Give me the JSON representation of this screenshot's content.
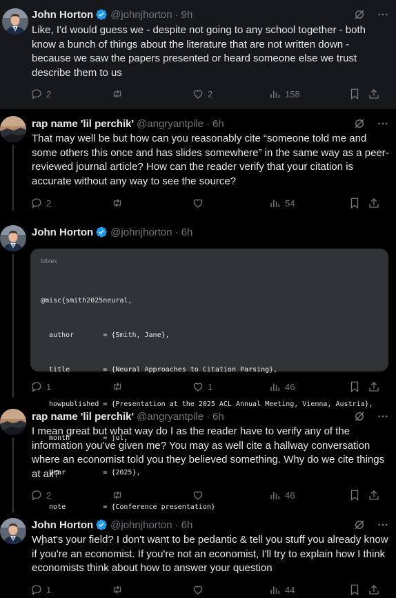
{
  "tweets": [
    {
      "name": "John Horton",
      "handle": "@johnjhorton",
      "time": "9h",
      "verified": true,
      "text": "Like, I'd would guess we - despite not going to any school together - both know a bunch of things about the literature that are not written down - because we saw the papers presented or heard someone else we trust describe them to us",
      "replies": "2",
      "retweets": "",
      "likes": "2",
      "views": "158"
    },
    {
      "name": "rap name 'lil perchik'",
      "handle": "@angryantpile",
      "time": "6h",
      "verified": false,
      "text": "That may well be but how can you reasonably cite “someone told me and some others this once and has slides somewhere” in the same way as a peer-reviewed journal article? How can the reader verify that your citation is accurate without any way to see the source?",
      "replies": "2",
      "retweets": "",
      "likes": "",
      "views": "54"
    },
    {
      "name": "John Horton",
      "handle": "@johnjhorton",
      "time": "6h",
      "verified": true,
      "code": {
        "language": "bibtex",
        "lines": [
          "@misc{smith2025neural,",
          "  author       = {Smith, Jane},",
          "  title        = {Neural Approaches to Citation Parsing},",
          "  howpublished = {Presentation at the 2025 ACL Annual Meeting, Vienna, Austria},",
          "  month        = jul,",
          "  year         = {2025},",
          "  note         = {Conference presentation}",
          "}"
        ]
      },
      "replies": "1",
      "retweets": "",
      "likes": "1",
      "views": "46"
    },
    {
      "name": "rap name 'lil perchik'",
      "handle": "@angryantpile",
      "time": "6h",
      "verified": false,
      "text": "I mean great but what way do I as the reader have to verify any of the information you’ve given me? You may as well cite a hallway conversation where an economist told you they believed something. Why do we cite things at all?",
      "replies": "2",
      "retweets": "",
      "likes": "",
      "views": "46"
    },
    {
      "name": "John Horton",
      "handle": "@johnjhorton",
      "time": "6h",
      "verified": true,
      "text": "What's your field? I don't want to be pedantic & tell you stuff you already know if you're an economist. If you're not an economist, I'll try to explain how I think economists think about how to answer your question",
      "replies": "1",
      "retweets": "",
      "likes": "",
      "views": "44"
    }
  ],
  "colors": {
    "background": "#000000",
    "highlight": "#16181c",
    "text": "#e7e9ea",
    "muted": "#71767b",
    "verified": "#1d9bf0",
    "code_bg": "#2f3336"
  }
}
